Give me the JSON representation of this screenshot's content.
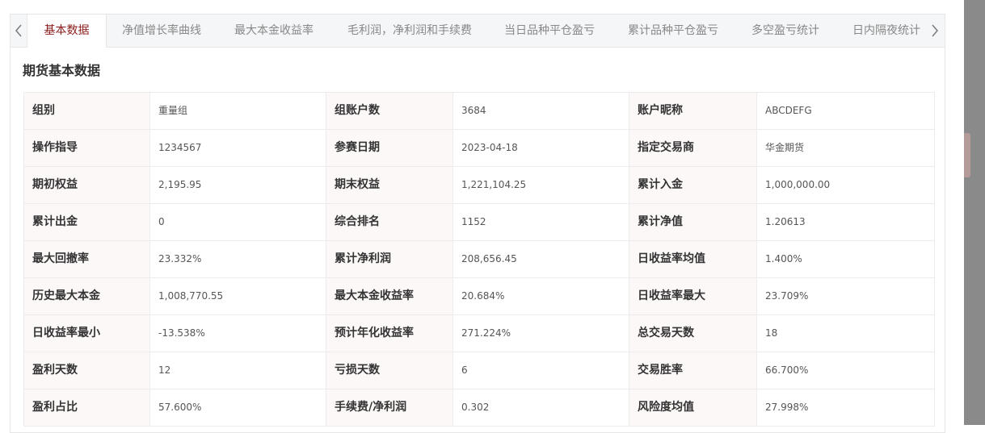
{
  "tabs": [
    {
      "label": "基本数据",
      "active": true
    },
    {
      "label": "净值增长率曲线"
    },
    {
      "label": "最大本金收益率"
    },
    {
      "label": "毛利润，净利润和手续费"
    },
    {
      "label": "当日品种平仓盈亏"
    },
    {
      "label": "累计品种平仓盈亏"
    },
    {
      "label": "多空盈亏统计"
    },
    {
      "label": "日内隔夜统计"
    }
  ],
  "section_title": "期货基本数据",
  "rows": [
    [
      [
        "组别",
        "重量组"
      ],
      [
        "组账户数",
        "3684"
      ],
      [
        "账户昵称",
        "ABCDEFG"
      ]
    ],
    [
      [
        "操作指导",
        "1234567"
      ],
      [
        "参赛日期",
        "2023-04-18"
      ],
      [
        "指定交易商",
        "华金期货"
      ]
    ],
    [
      [
        "期初权益",
        "2,195.95"
      ],
      [
        "期末权益",
        "1,221,104.25"
      ],
      [
        "累计入金",
        "1,000,000.00"
      ]
    ],
    [
      [
        "累计出金",
        "0"
      ],
      [
        "综合排名",
        "1152"
      ],
      [
        "累计净值",
        "1.20613"
      ]
    ],
    [
      [
        "最大回撤率",
        "23.332%"
      ],
      [
        "累计净利润",
        "208,656.45"
      ],
      [
        "日收益率均值",
        "1.400%"
      ]
    ],
    [
      [
        "历史最大本金",
        "1,008,770.55"
      ],
      [
        "最大本金收益率",
        "20.684%"
      ],
      [
        "日收益率最大",
        "23.709%"
      ]
    ],
    [
      [
        "日收益率最小",
        "-13.538%"
      ],
      [
        "预计年化收益率",
        "271.224%"
      ],
      [
        "总交易天数",
        "18"
      ]
    ],
    [
      [
        "盈利天数",
        "12"
      ],
      [
        "亏损天数",
        "6"
      ],
      [
        "交易胜率",
        "66.700%"
      ]
    ],
    [
      [
        "盈利占比",
        "57.600%"
      ],
      [
        "手续费/净利润",
        "0.302"
      ],
      [
        "风险度均值",
        "27.998%"
      ]
    ]
  ],
  "colors": {
    "accent": "#8b1a1a",
    "label_bg": "#fdf8f8",
    "tabbar_bg": "#f5f6f8"
  }
}
